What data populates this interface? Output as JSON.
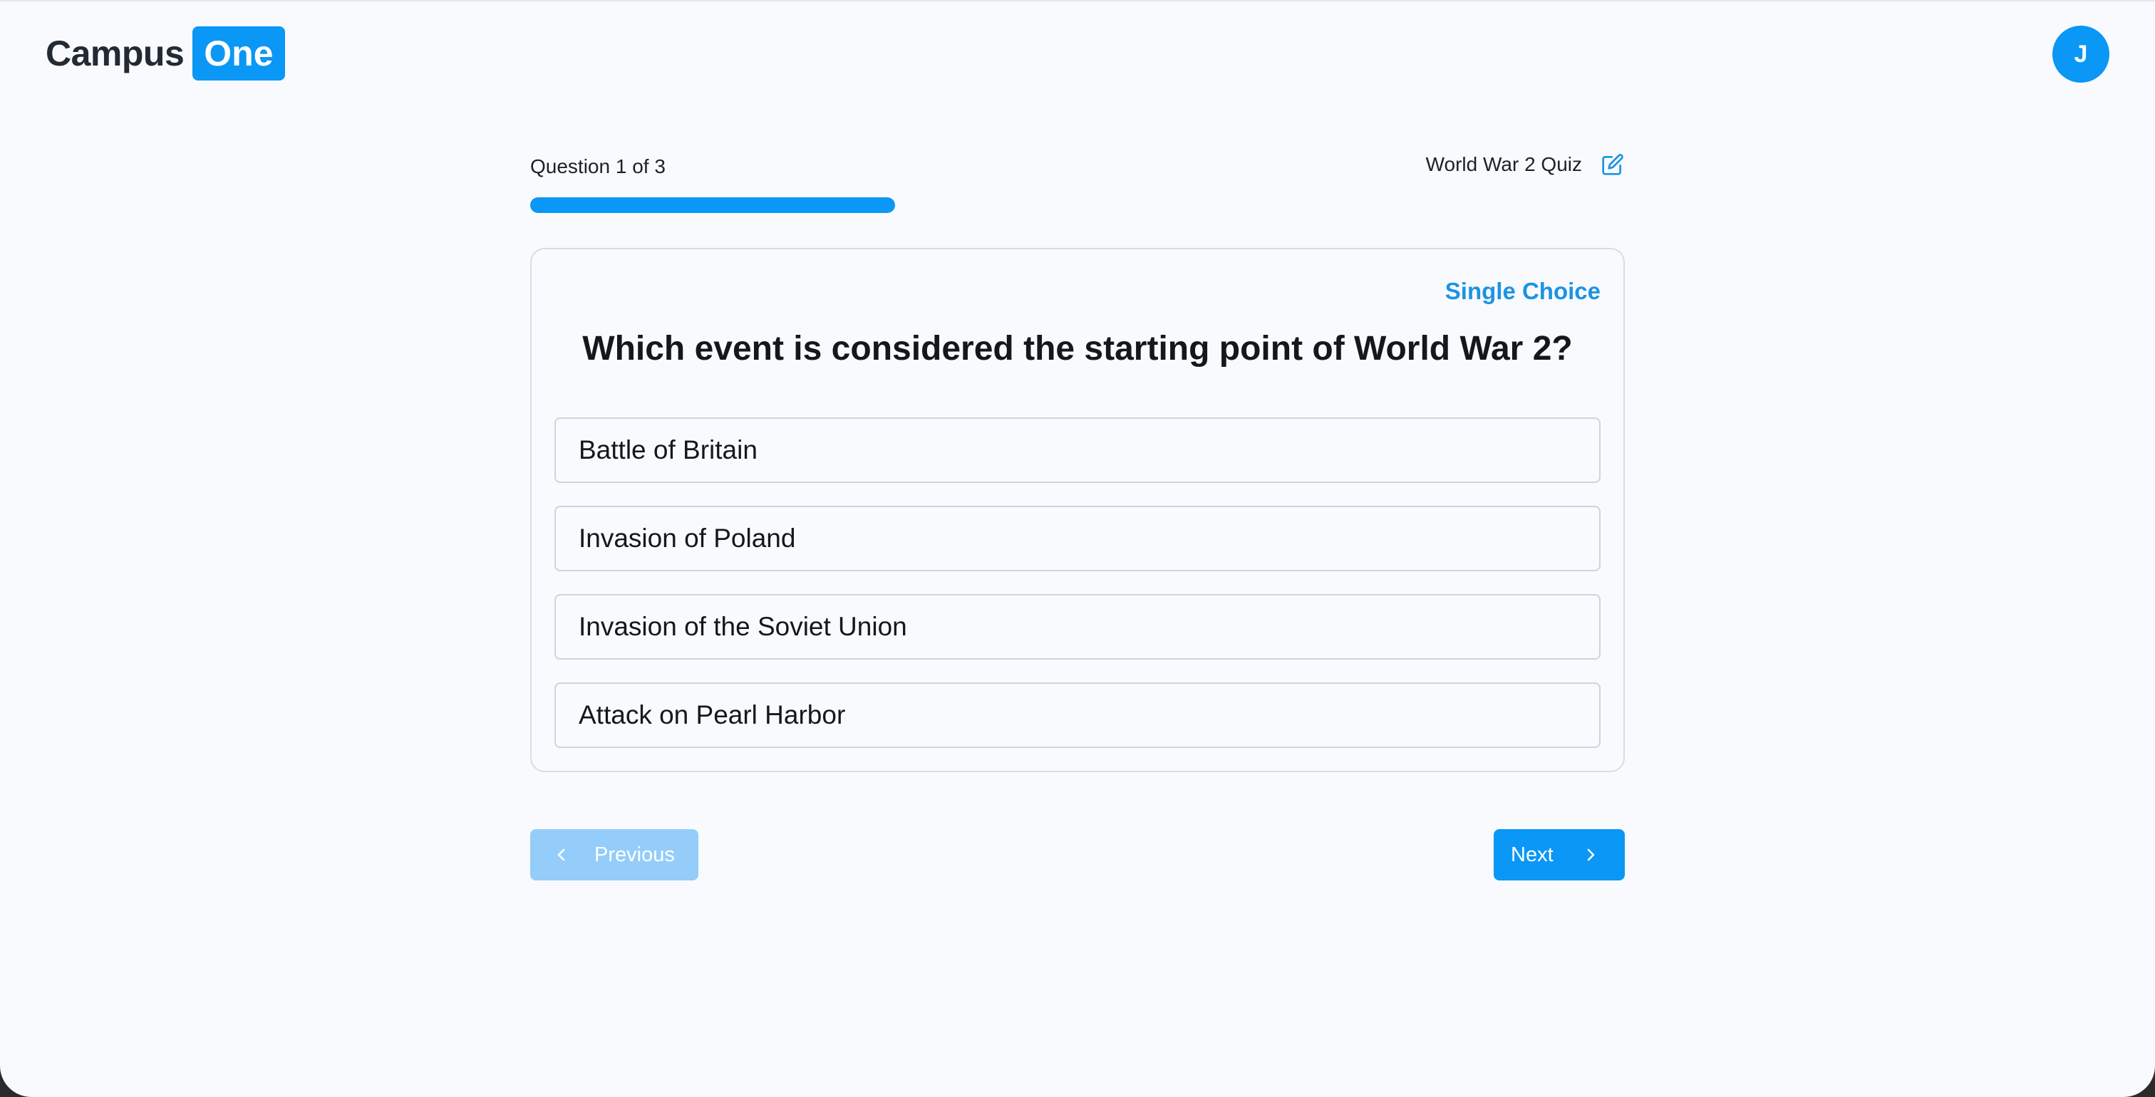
{
  "header": {
    "brand_primary": "Campus",
    "brand_badge": "One",
    "avatar_initial": "J"
  },
  "quiz": {
    "counter_text": "Question 1 of 3",
    "progress_fraction": 0.3333,
    "title": "World War 2 Quiz",
    "edit_icon": "edit-pencil-icon"
  },
  "question": {
    "type_label": "Single Choice",
    "text": "Which event is considered the starting point of World War 2?",
    "options": [
      "Battle of Britain",
      "Invasion of Poland",
      "Invasion of the Soviet Union",
      "Attack on Pearl Harbor"
    ]
  },
  "navigation": {
    "previous_label": "Previous",
    "previous_enabled": false,
    "next_label": "Next",
    "previous_icon": "chevron-left-icon",
    "next_icon": "chevron-right-icon"
  },
  "colors": {
    "accent": "#0a97f5",
    "accent_disabled": "#94cdf9",
    "background": "#f8fafd",
    "text": "#14181d",
    "border": "#cfd4db"
  }
}
